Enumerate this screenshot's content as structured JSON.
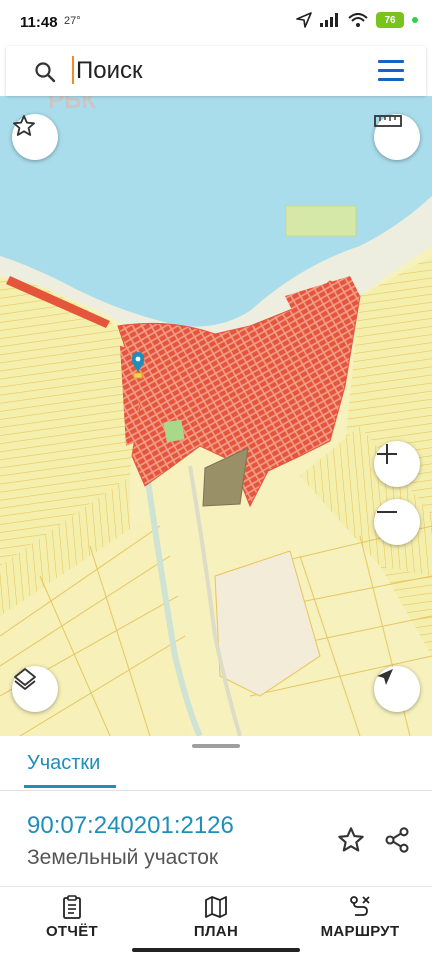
{
  "status_bar": {
    "time": "11:48",
    "temperature": "27°",
    "battery": "76"
  },
  "search": {
    "placeholder": "Поиск"
  },
  "map": {
    "water_color": "#a8dcea",
    "land_color": "#f5f0b4",
    "parcel_color": "#f0e8a0",
    "building_color": "#e8583f",
    "pin_color": "#1e8fb8",
    "watermark": "РБК"
  },
  "sheet": {
    "tab_label": "Участки",
    "parcel_number": "90:07:240201:2126",
    "parcel_type": "Земельный участок"
  },
  "nav": {
    "report_label": "ОТЧЁТ",
    "plan_label": "ПЛАН",
    "route_label": "МАРШРУТ"
  },
  "colors": {
    "accent": "#1e8fb8",
    "menu": "#1565c0"
  }
}
